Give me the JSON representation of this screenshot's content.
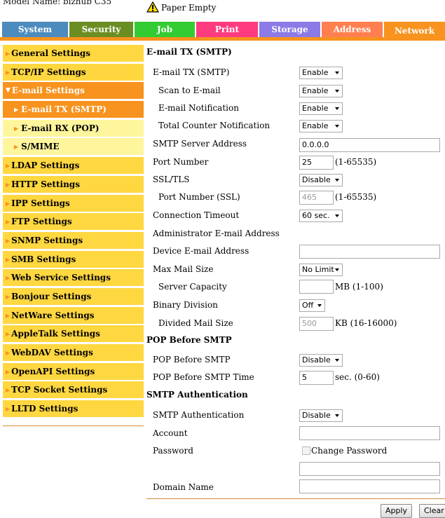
{
  "header": {
    "model_name": "Model Name: bizhub C35",
    "status_text": "Paper Empty",
    "status_icon": "warning-icon"
  },
  "tabs": [
    {
      "label": "System",
      "color": "#4b8bbe"
    },
    {
      "label": "Security",
      "color": "#6b8e23"
    },
    {
      "label": "Job",
      "color": "#33cc33"
    },
    {
      "label": "Print",
      "color": "#ff3b7f"
    },
    {
      "label": "Storage",
      "color": "#8c7ae6"
    },
    {
      "label": "Address",
      "color": "#ff7f50"
    },
    {
      "label": "Network",
      "color": "#f7931e"
    }
  ],
  "sidebar": {
    "items": [
      {
        "label": "General Settings"
      },
      {
        "label": "TCP/IP Settings"
      },
      {
        "label": "E-mail Settings"
      },
      {
        "label": "E-mail TX (SMTP)"
      },
      {
        "label": "E-mail RX (POP)"
      },
      {
        "label": "S/MIME"
      },
      {
        "label": "LDAP Settings"
      },
      {
        "label": "HTTP Settings"
      },
      {
        "label": "IPP Settings"
      },
      {
        "label": "FTP Settings"
      },
      {
        "label": "SNMP Settings"
      },
      {
        "label": "SMB Settings"
      },
      {
        "label": "Web Service Settings"
      },
      {
        "label": "Bonjour Settings"
      },
      {
        "label": "NetWare Settings"
      },
      {
        "label": "AppleTalk Settings"
      },
      {
        "label": "WebDAV Settings"
      },
      {
        "label": "OpenAPI Settings"
      },
      {
        "label": "TCP Socket Settings"
      },
      {
        "label": "LLTD Settings"
      }
    ]
  },
  "main": {
    "sections": {
      "smtp": "E-mail TX (SMTP)",
      "pop": "POP Before SMTP",
      "auth": "SMTP Authentication"
    },
    "fields": {
      "email_tx": {
        "label": "E-mail TX (SMTP)",
        "value": "Enable"
      },
      "scan_to_email": {
        "label": "Scan to E-mail",
        "value": "Enable"
      },
      "email_notification": {
        "label": "E-mail Notification",
        "value": "Enable"
      },
      "total_counter": {
        "label": "Total Counter Notification",
        "value": "Enable"
      },
      "smtp_server": {
        "label": "SMTP Server Address",
        "value": "0.0.0.0"
      },
      "port_number": {
        "label": "Port Number",
        "value": "25",
        "range": "(1-65535)"
      },
      "ssl_tls": {
        "label": "SSL/TLS",
        "value": "Disable"
      },
      "port_ssl": {
        "label": "Port Number (SSL)",
        "value": "465",
        "range": "(1-65535)"
      },
      "conn_timeout": {
        "label": "Connection Timeout",
        "value": "60 sec."
      },
      "admin_email": {
        "label": "Administrator E-mail Address"
      },
      "device_email": {
        "label": "Device E-mail Address",
        "value": ""
      },
      "max_mail_size": {
        "label": "Max Mail Size",
        "value": "No Limit"
      },
      "server_capacity": {
        "label": "Server Capacity",
        "value": "",
        "unit": "MB (1-100)"
      },
      "binary_division": {
        "label": "Binary Division",
        "value": "Off"
      },
      "divided_mail_size": {
        "label": "Divided Mail Size",
        "value": "500",
        "unit": "KB (16-16000)"
      },
      "pop_before_smtp": {
        "label": "POP Before SMTP",
        "value": "Disable"
      },
      "pop_time": {
        "label": "POP Before SMTP Time",
        "value": "5",
        "unit": "sec. (0-60)"
      },
      "smtp_auth": {
        "label": "SMTP Authentication",
        "value": "Disable"
      },
      "account": {
        "label": "Account",
        "value": ""
      },
      "password": {
        "label": "Password",
        "change_label": "Change Password",
        "value": ""
      },
      "domain": {
        "label": "Domain Name",
        "value": ""
      }
    }
  },
  "buttons": {
    "apply": "Apply",
    "clear": "Clear"
  }
}
